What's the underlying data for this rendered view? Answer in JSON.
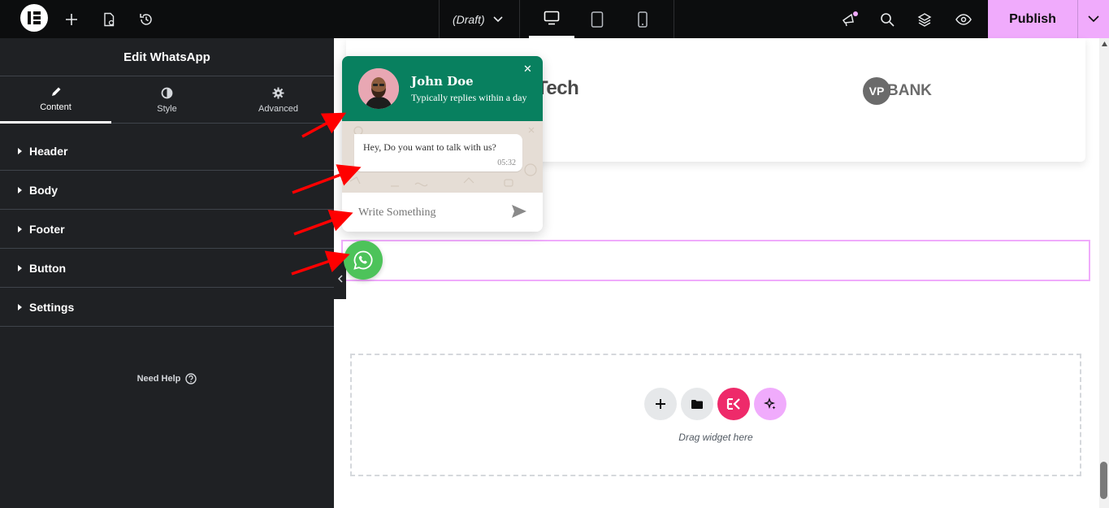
{
  "topbar": {
    "draft_label": "(Draft)",
    "publish_label": "Publish"
  },
  "panel": {
    "title": "Edit WhatsApp",
    "tabs": [
      {
        "label": "Content",
        "icon": "pencil-icon",
        "active": true
      },
      {
        "label": "Style",
        "icon": "half-circle-icon",
        "active": false
      },
      {
        "label": "Advanced",
        "icon": "gear-icon",
        "active": false
      }
    ],
    "sections": [
      "Header",
      "Body",
      "Footer",
      "Button",
      "Settings"
    ],
    "need_help": "Need Help"
  },
  "canvas": {
    "logo_left": "Tech",
    "logo_right_mark": "VP",
    "logo_right_text": "BANK",
    "drop_label": "Drag widget here"
  },
  "whatsapp": {
    "name": "John Doe",
    "subtitle": "Typically replies within a day",
    "message": "Hey, Do you want to talk with us?",
    "time": "05:32",
    "input_placeholder": "Write Something",
    "header_color": "#08805f",
    "fab_color": "#4dc35a"
  },
  "colors": {
    "publish_bg": "#f0abfc",
    "panel_bg": "#1f2124",
    "annotation_arrow": "#ff0000",
    "elementor_kit": "#ee2a6a"
  }
}
